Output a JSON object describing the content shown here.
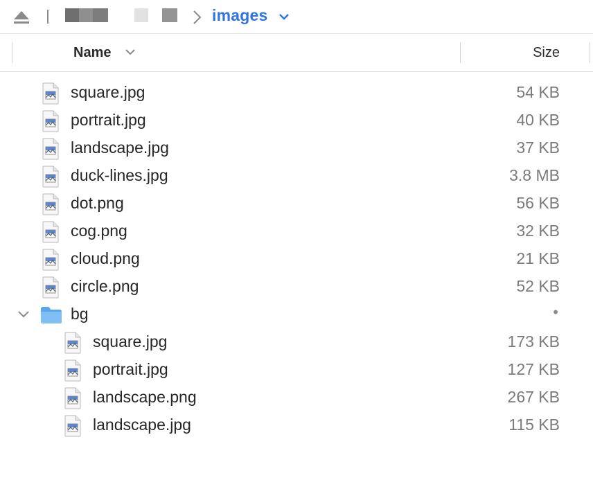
{
  "toolbar": {
    "eject_icon": "eject-icon",
    "breadcrumb_chevron_icon": "chevron-right-icon",
    "current_folder": "images",
    "current_folder_menu_icon": "chevron-down-icon"
  },
  "columns": {
    "name_label": "Name",
    "name_sort_icon": "chevron-down-icon",
    "size_label": "Size"
  },
  "files_top": [
    {
      "name": "square.jpg",
      "size": "54 KB",
      "icon": "image-file-icon"
    },
    {
      "name": "portrait.jpg",
      "size": "40 KB",
      "icon": "image-file-icon"
    },
    {
      "name": "landscape.jpg",
      "size": "37 KB",
      "icon": "image-file-icon"
    },
    {
      "name": "duck-lines.jpg",
      "size": "3.8 MB",
      "icon": "image-file-icon"
    },
    {
      "name": "dot.png",
      "size": "56 KB",
      "icon": "image-file-icon"
    },
    {
      "name": "cog.png",
      "size": "32 KB",
      "icon": "image-file-icon"
    },
    {
      "name": "cloud.png",
      "size": "21 KB",
      "icon": "image-file-icon"
    },
    {
      "name": "circle.png",
      "size": "52 KB",
      "icon": "image-file-icon"
    }
  ],
  "folder": {
    "name": "bg",
    "size": "•",
    "expanded": true,
    "icon": "folder-icon",
    "disclosure_icon": "chevron-down-icon",
    "children": [
      {
        "name": "square.jpg",
        "size": "173 KB",
        "icon": "image-file-icon"
      },
      {
        "name": "portrait.jpg",
        "size": "127 KB",
        "icon": "image-file-icon"
      },
      {
        "name": "landscape.png",
        "size": "267 KB",
        "icon": "image-file-icon"
      },
      {
        "name": "landscape.jpg",
        "size": "115 KB",
        "icon": "image-file-icon"
      }
    ]
  },
  "colors": {
    "accent": "#2f74e0",
    "folder": "#6fb4f2",
    "size_text": "#7a7a7a"
  }
}
